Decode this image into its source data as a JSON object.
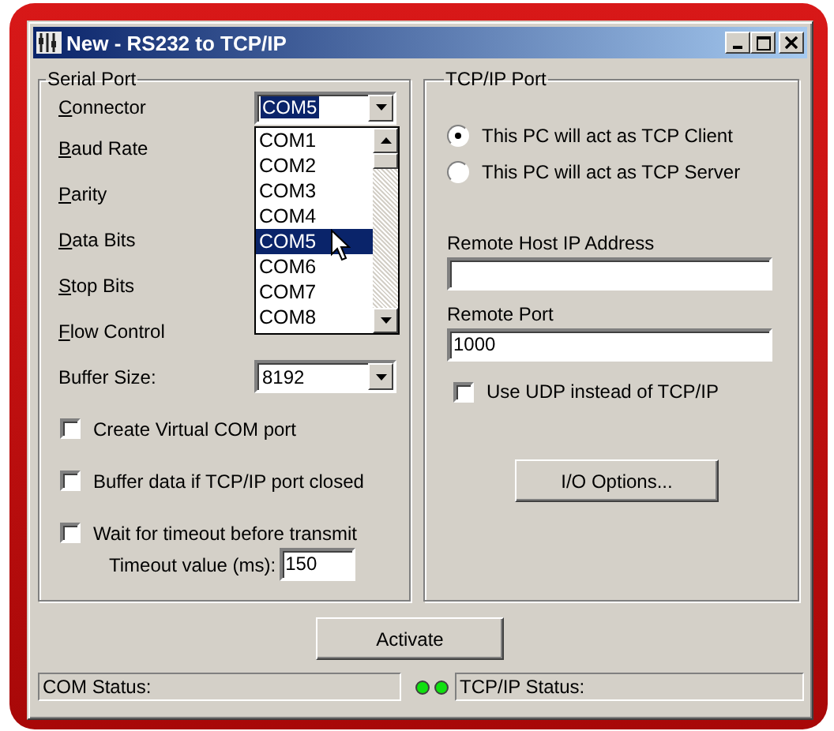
{
  "window": {
    "title": "New - RS232 to TCP/IP"
  },
  "serial_port": {
    "title": "Serial Port",
    "fields": [
      {
        "label": "Connector",
        "first_letter_underlined": true,
        "value": "COM5",
        "highlighted": true
      },
      {
        "label": "Baud Rate",
        "first_letter_underlined": true
      },
      {
        "label": "Parity",
        "first_letter_underlined": true
      },
      {
        "label": "Data Bits",
        "first_letter_underlined": true
      },
      {
        "label": "Stop Bits",
        "first_letter_underlined": true
      },
      {
        "label": "Flow Control",
        "first_letter_underlined": true
      },
      {
        "label": "Buffer Size:",
        "first_letter_underlined": false,
        "value": "8192",
        "highlighted": false
      }
    ],
    "dropdown": [
      {
        "label": "COM1",
        "selected": false
      },
      {
        "label": "COM2",
        "selected": false
      },
      {
        "label": "COM3",
        "selected": false
      },
      {
        "label": "COM4",
        "selected": false
      },
      {
        "label": "COM5",
        "selected": true
      },
      {
        "label": "COM6",
        "selected": false
      },
      {
        "label": "COM7",
        "selected": false
      },
      {
        "label": "COM8",
        "selected": false
      }
    ],
    "options": [
      {
        "label": "Create Virtual COM port",
        "checked": false
      },
      {
        "label": "Buffer data if TCP/IP port closed",
        "checked": false
      },
      {
        "label": "Wait for timeout before transmit",
        "checked": false
      }
    ],
    "timeout": {
      "label": "Timeout value (ms):",
      "value": "150"
    }
  },
  "tcpip_port": {
    "title": "TCP/IP Port",
    "modes": [
      {
        "label": "This PC will act as TCP Client",
        "selected": true
      },
      {
        "label": "This PC will act as TCP Server",
        "selected": false
      }
    ],
    "host": {
      "label": "Remote Host IP Address"
    },
    "port": {
      "label": "Remote Port",
      "value": "1000"
    },
    "udp": {
      "label": "Use UDP instead of TCP/IP",
      "checked": false
    },
    "io_button": "I/O Options..."
  },
  "activate_button": "Activate",
  "status_bar": {
    "com": "COM Status:",
    "leds": [
      {
        "on": true
      },
      {
        "on": true
      }
    ],
    "tcpip": "TCP/IP Status:"
  }
}
